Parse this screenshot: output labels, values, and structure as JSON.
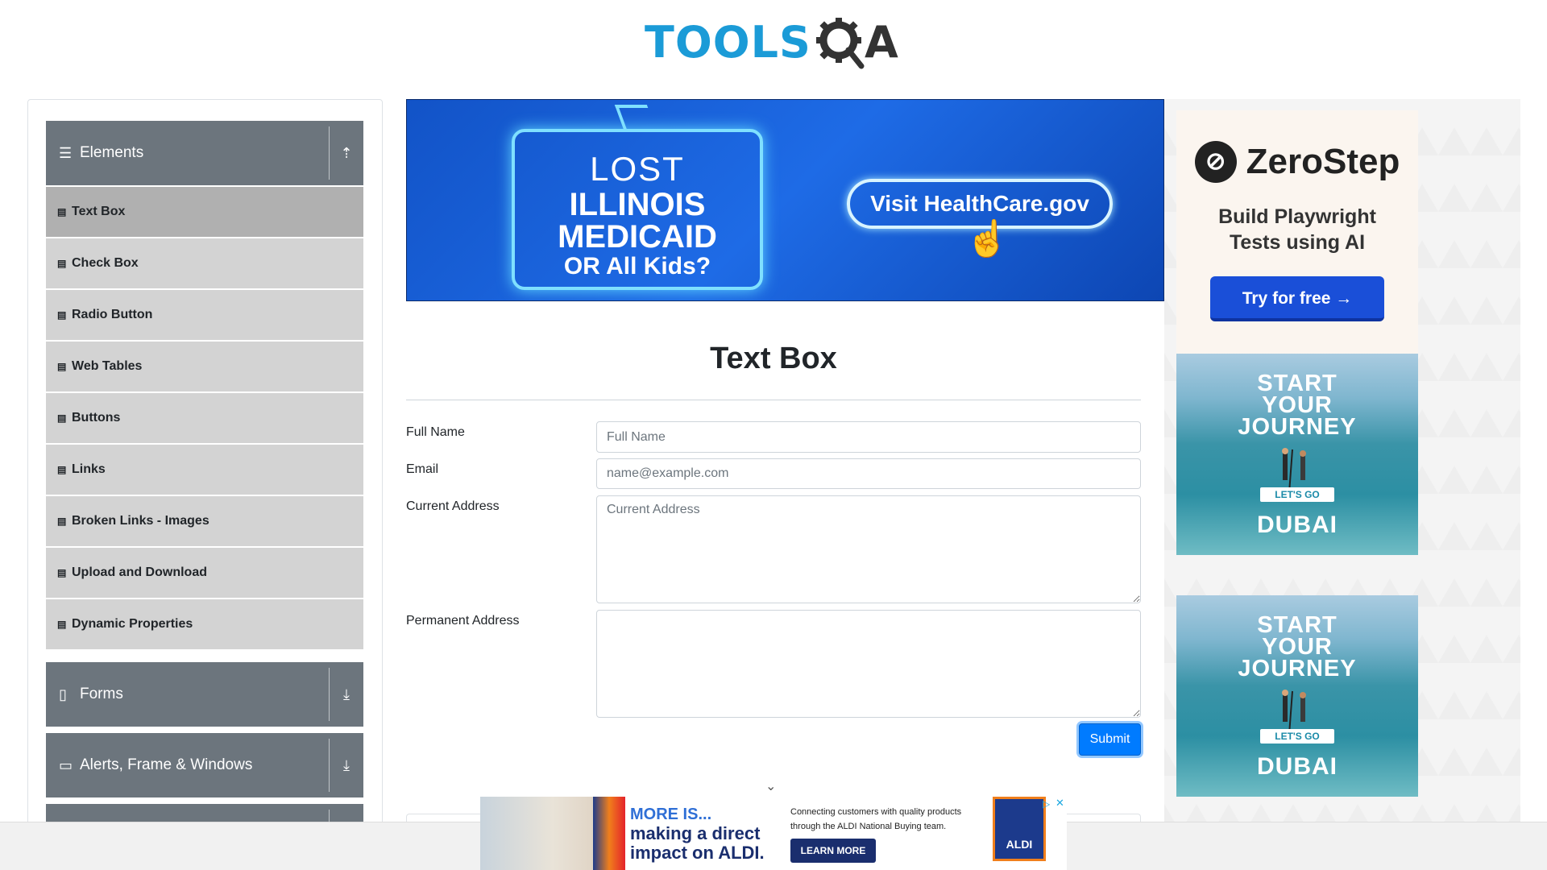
{
  "brand": {
    "logo_text": "TOOLS",
    "logo_suffix": "A",
    "colors": {
      "blue": "#1b9bd7",
      "dark": "#333333"
    }
  },
  "sidebar": {
    "groups": [
      {
        "label": "Elements",
        "icon": "hamburger-icon",
        "toggle": "arrow-up-icon"
      },
      {
        "label": "Forms",
        "icon": "form-icon",
        "toggle": "arrow-down-icon"
      },
      {
        "label": "Alerts, Frame & Windows",
        "icon": "window-icon",
        "toggle": "arrow-down-icon"
      }
    ],
    "items": [
      {
        "label": "Text Box",
        "active": true
      },
      {
        "label": "Check Box"
      },
      {
        "label": "Radio Button"
      },
      {
        "label": "Web Tables"
      },
      {
        "label": "Buttons"
      },
      {
        "label": "Links"
      },
      {
        "label": "Broken Links - Images"
      },
      {
        "label": "Upload and Download"
      },
      {
        "label": "Dynamic Properties"
      }
    ]
  },
  "top_ad": {
    "line1": "LOST",
    "line2": "ILLINOIS",
    "line3": "MEDICAID",
    "line4": "OR All Kids?",
    "cta": "Visit HealthCare.gov"
  },
  "main": {
    "title": "Text Box",
    "form": {
      "full_name_label": "Full Name",
      "full_name_placeholder": "Full Name",
      "email_label": "Email",
      "email_placeholder": "name@example.com",
      "current_address_label": "Current Address",
      "current_address_placeholder": "Current Address",
      "permanent_address_label": "Permanent Address",
      "submit_label": "Submit"
    }
  },
  "right_ads": {
    "zerostep": {
      "brand": "ZeroStep",
      "tagline_1": "Build Playwright",
      "tagline_2": "Tests using AI",
      "cta": "Try for free →"
    },
    "dubai": {
      "line1": "START",
      "line2": "YOUR",
      "line3": "JOURNEY",
      "cta": "LET'S GO",
      "brand": "DUBAI"
    }
  },
  "bottom_ad": {
    "more": "MORE IS...",
    "headline_1": "making a direct",
    "headline_2": "impact on ALDI.",
    "copy": "Connecting customers with quality products through the ALDI National Buying team.",
    "cta": "LEARN MORE",
    "brand": "ALDI"
  }
}
